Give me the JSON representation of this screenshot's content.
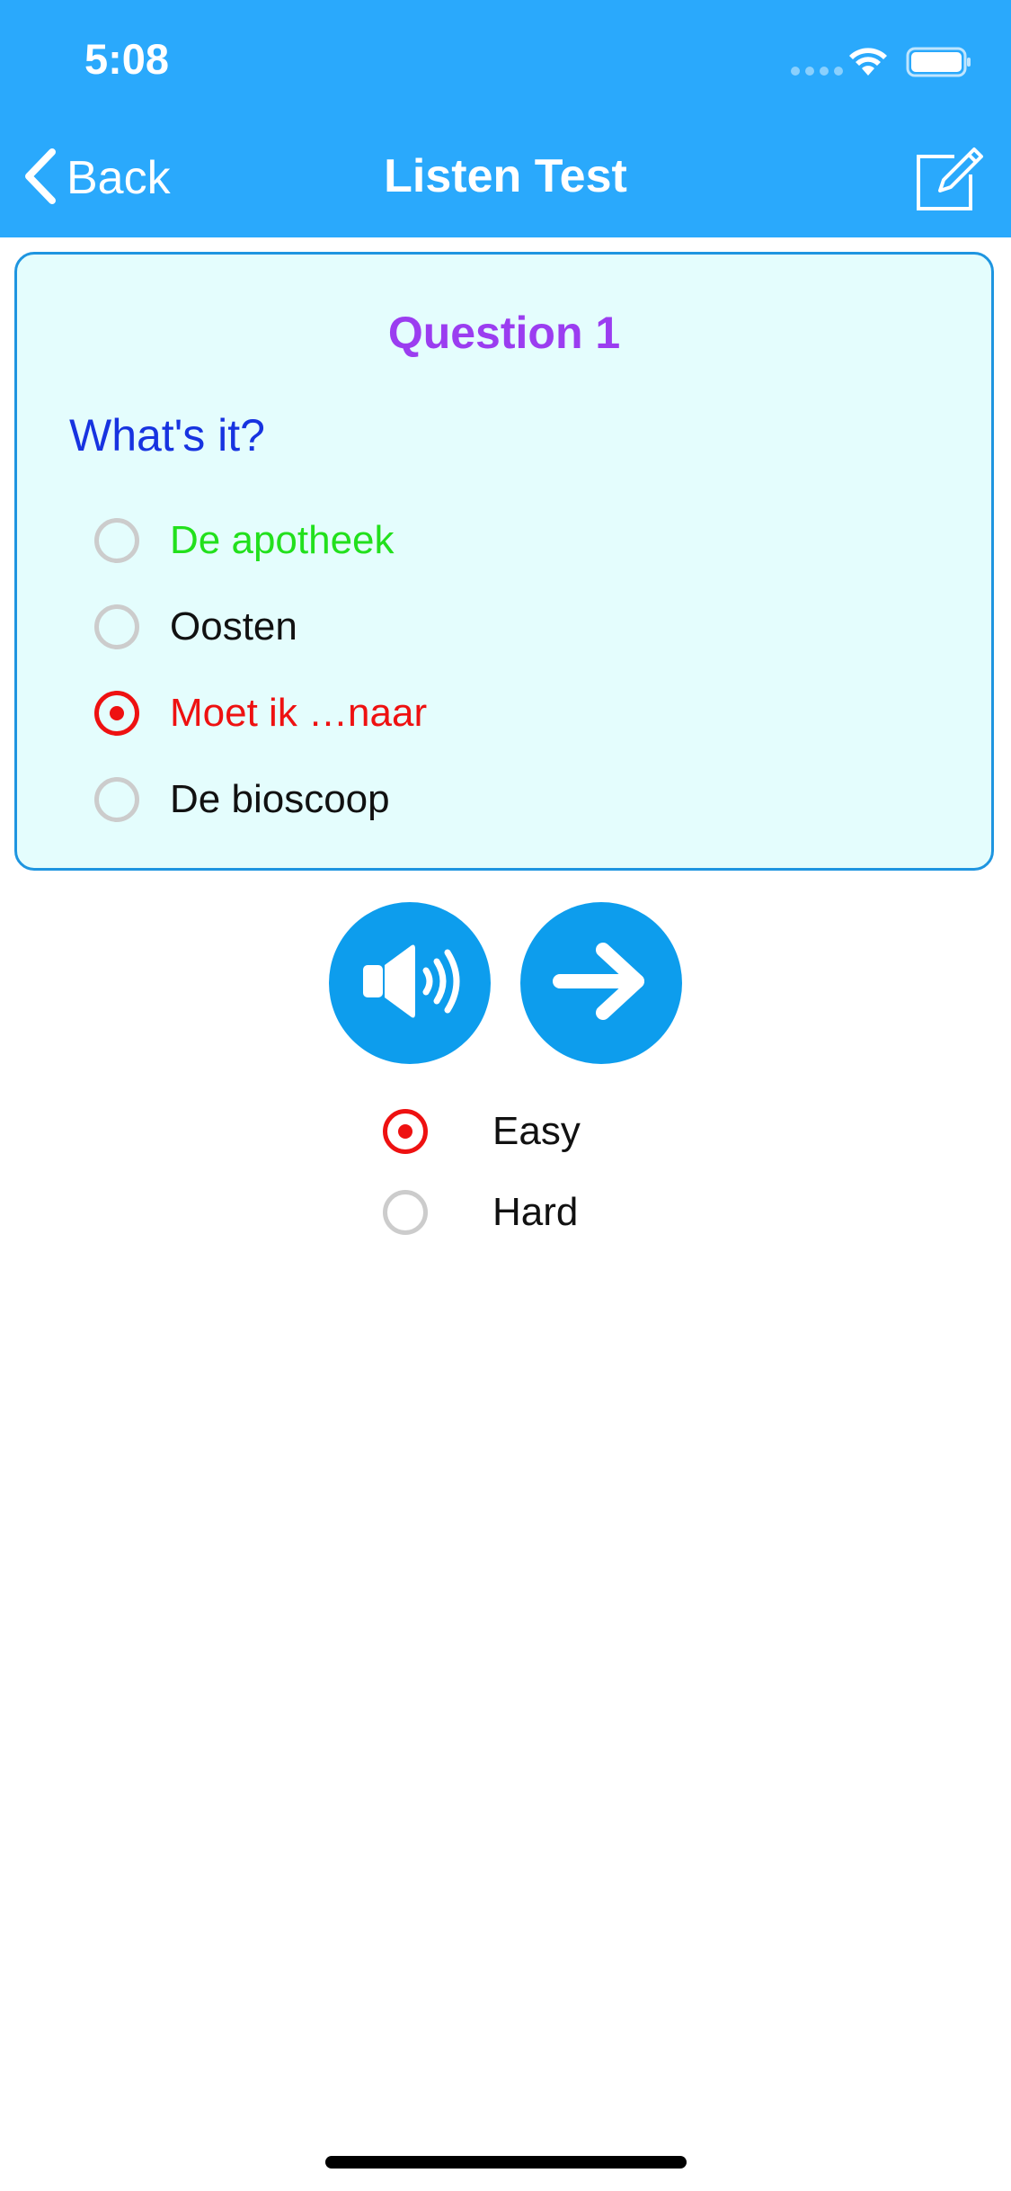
{
  "status_bar": {
    "time": "5:08"
  },
  "nav": {
    "back_label": "Back",
    "title": "Listen Test",
    "back_icon": "chevron-left-icon",
    "edit_icon": "edit-icon"
  },
  "question": {
    "heading": "Question 1",
    "prompt": "What's it?",
    "options": [
      {
        "label": "De apotheek",
        "selected": false,
        "color": "#22e01c",
        "state": "correct"
      },
      {
        "label": "Oosten",
        "selected": false,
        "color": "#111111",
        "state": "neutral"
      },
      {
        "label": "Moet ik …naar",
        "selected": true,
        "color": "#ee1111",
        "state": "wrong"
      },
      {
        "label": "De bioscoop",
        "selected": false,
        "color": "#111111",
        "state": "neutral"
      }
    ]
  },
  "controls": {
    "speaker_icon": "speaker-icon",
    "next_icon": "arrow-right-icon"
  },
  "difficulty": {
    "options": [
      {
        "label": "Easy",
        "selected": true
      },
      {
        "label": "Hard",
        "selected": false
      }
    ]
  },
  "colors": {
    "nav_bar": "#2aa9fc",
    "card_background": "#e4fdfd",
    "card_border": "#1e95e0",
    "heading": "#9b3df0",
    "prompt": "#1733e0",
    "button": "#0d9ded",
    "selected_radio": "#ee1111",
    "correct": "#22e01c"
  }
}
